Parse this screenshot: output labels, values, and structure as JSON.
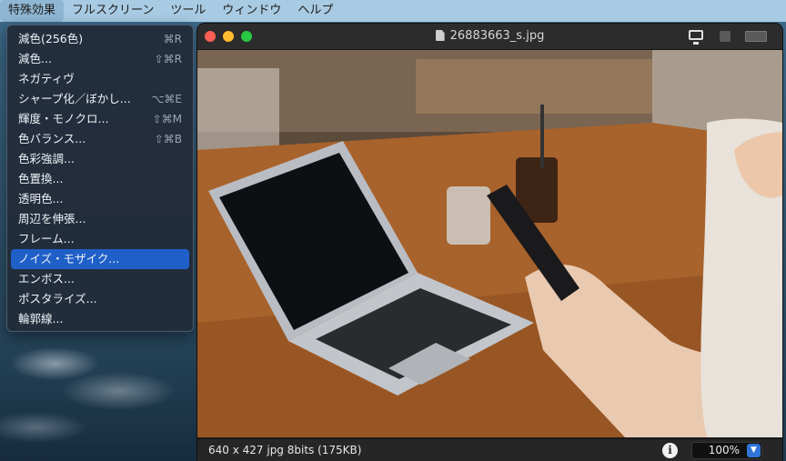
{
  "menubar": {
    "items": [
      "特殊効果",
      "フルスクリーン",
      "ツール",
      "ウィンドウ",
      "ヘルプ"
    ]
  },
  "menu": {
    "items": [
      {
        "label": "減色(256色)",
        "shortcut": "⌘R"
      },
      {
        "label": "減色...",
        "shortcut": "⇧⌘R"
      },
      {
        "label": "ネガティヴ",
        "shortcut": ""
      },
      {
        "label": "シャープ化／ぼかし...",
        "shortcut": "⌥⌘E"
      },
      {
        "label": "輝度・モノクロ...",
        "shortcut": "⇧⌘M"
      },
      {
        "label": "色バランス...",
        "shortcut": "⇧⌘B"
      },
      {
        "label": "色彩強調...",
        "shortcut": ""
      },
      {
        "label": "色置換...",
        "shortcut": ""
      },
      {
        "label": "透明色...",
        "shortcut": ""
      },
      {
        "label": "周辺を伸張...",
        "shortcut": ""
      },
      {
        "label": "フレーム...",
        "shortcut": ""
      },
      {
        "label": "ノイズ・モザイク...",
        "shortcut": ""
      },
      {
        "label": "エンボス...",
        "shortcut": ""
      },
      {
        "label": "ポスタライズ...",
        "shortcut": ""
      },
      {
        "label": "輪郭線...",
        "shortcut": ""
      }
    ],
    "selected_index": 11
  },
  "window": {
    "title": "26883663_s.jpg",
    "status_info": "640 x 427  jpg  8bits (175KB)",
    "zoom": "100%"
  },
  "colors": {
    "menu_highlight": "#1f5fc8",
    "close": "#fe5f57",
    "minimize": "#febc2e",
    "zoom": "#28c840"
  }
}
